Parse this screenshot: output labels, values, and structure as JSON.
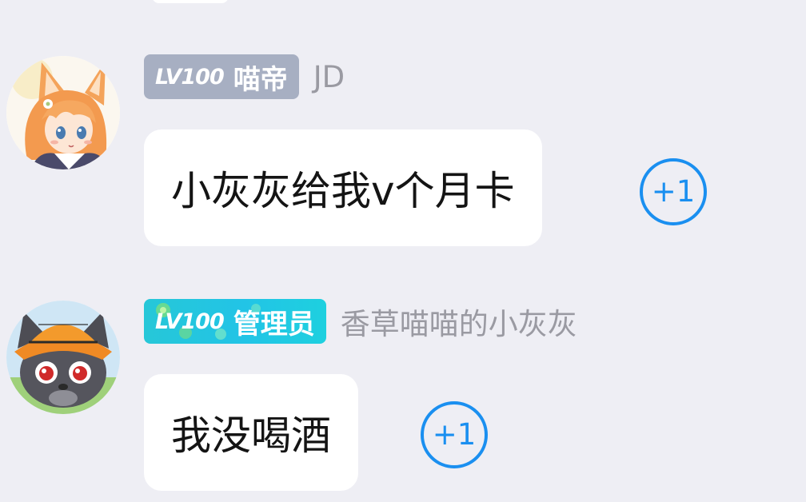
{
  "messages": [
    {
      "badge": {
        "level": "LV100",
        "title": "喵帝",
        "color": "#a7afc2"
      },
      "username": "JD",
      "text": "小灰灰给我v个月卡",
      "plus_one": "+1"
    },
    {
      "badge": {
        "level": "LV100",
        "title": "管理员",
        "color": "#26c7d8"
      },
      "username": "香草喵喵的小灰灰",
      "text": "我没喝酒",
      "plus_one": "+1"
    }
  ],
  "colors": {
    "background": "#eeeef4",
    "bubble": "#ffffff",
    "accent": "#1a8ff0",
    "username": "#9a9aa2"
  }
}
